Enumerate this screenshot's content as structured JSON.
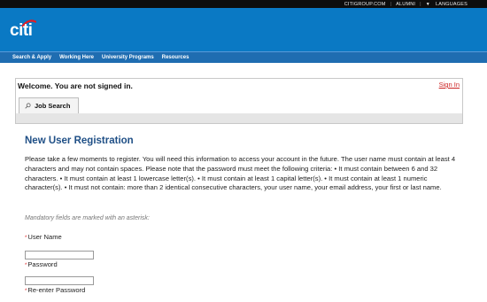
{
  "top_links": {
    "citigroup": "CITIGROUP.COM",
    "alumni": "ALUMNI",
    "languages": "LANGUAGES"
  },
  "brand": {
    "logo_text": "citi",
    "banner_color": "#0a79c4",
    "nav_color": "#1f6db1"
  },
  "nav": {
    "items": [
      {
        "label": "Search & Apply"
      },
      {
        "label": "Working Here"
      },
      {
        "label": "University Programs"
      },
      {
        "label": "Resources"
      }
    ]
  },
  "welcome": {
    "message": "Welcome. You are not signed in.",
    "sign_in": "Sign In"
  },
  "tabs": [
    {
      "label": "Job Search",
      "icon": "search-icon"
    }
  ],
  "registration": {
    "title": "New User Registration",
    "instructions": "Please take a few moments to register. You will need this information to access your account in the future. The user name must contain at least 4 characters and may not contain spaces. Please note that the password must meet the following criteria: • It must contain between 6 and 32 characters. • It must contain at least 1 lowercase letter(s). • It must contain at least 1 capital letter(s). • It must contain at least 1 numeric character(s). • It must not contain: more than 2 identical consecutive characters, your user name, your email address, your first or last name.",
    "mandatory_note": "Mandatory fields are marked with an asterisk:",
    "fields": [
      {
        "label": "User Name",
        "value": ""
      },
      {
        "label": "Password",
        "value": ""
      },
      {
        "label": "Re-enter Password",
        "value": ""
      }
    ],
    "required_marker": "*"
  }
}
